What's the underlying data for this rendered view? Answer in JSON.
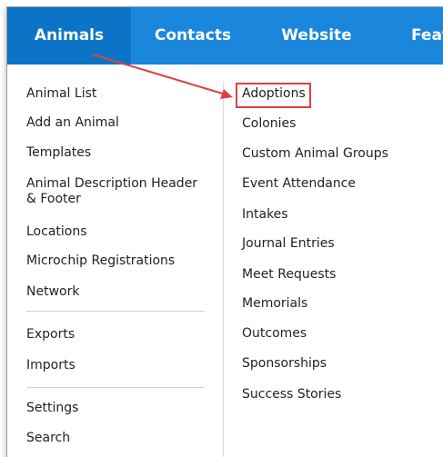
{
  "nav": {
    "tabs": [
      {
        "label": "Animals"
      },
      {
        "label": "Contacts"
      },
      {
        "label": "Website"
      },
      {
        "label": "Feat"
      }
    ]
  },
  "menu": {
    "left": [
      "Animal List",
      "Add an Animal",
      "Templates",
      "Animal Description Header & Footer",
      "Locations",
      "Microchip Registrations",
      "Network",
      "Exports",
      "Imports",
      "Settings",
      "Search"
    ],
    "right": [
      "Adoptions",
      "Colonies",
      "Custom Animal Groups",
      "Event Attendance",
      "Intakes",
      "Journal Entries",
      "Meet Requests",
      "Memorials",
      "Outcomes",
      "Sponsorships",
      "Success Stories"
    ]
  },
  "colors": {
    "nav_bg": "#1a86dc",
    "nav_active": "#0c74c7",
    "annotation": "#e04040"
  }
}
